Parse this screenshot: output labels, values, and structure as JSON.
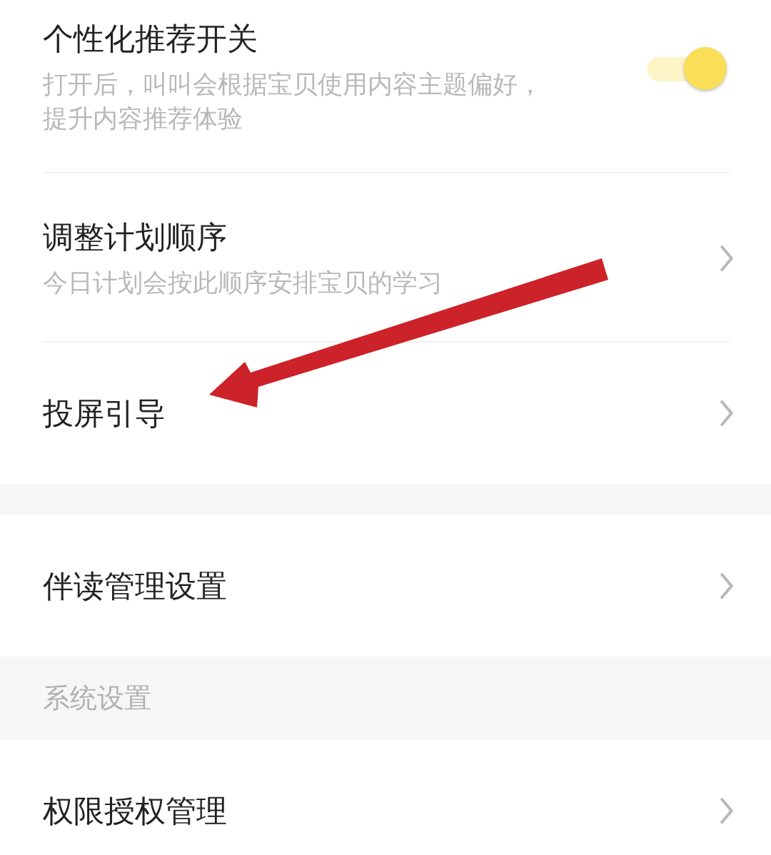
{
  "groups": [
    {
      "kind": "card",
      "rows": [
        {
          "kind": "toggle",
          "title": "个性化推荐开关",
          "description": "打开后，叫叫会根据宝贝使用内容主题偏好，提升内容推荐体验",
          "on": true
        },
        {
          "kind": "link",
          "title": "调整计划顺序",
          "description": "今日计划会按此顺序安排宝贝的学习"
        },
        {
          "kind": "link",
          "title": "投屏引导"
        }
      ]
    },
    {
      "kind": "card",
      "rows": [
        {
          "kind": "link",
          "title": "伴读管理设置"
        }
      ]
    },
    {
      "kind": "header",
      "title": "系统设置"
    },
    {
      "kind": "card",
      "rows": [
        {
          "kind": "link",
          "title": "权限授权管理"
        }
      ]
    }
  ],
  "annotation": {
    "kind": "arrow"
  }
}
